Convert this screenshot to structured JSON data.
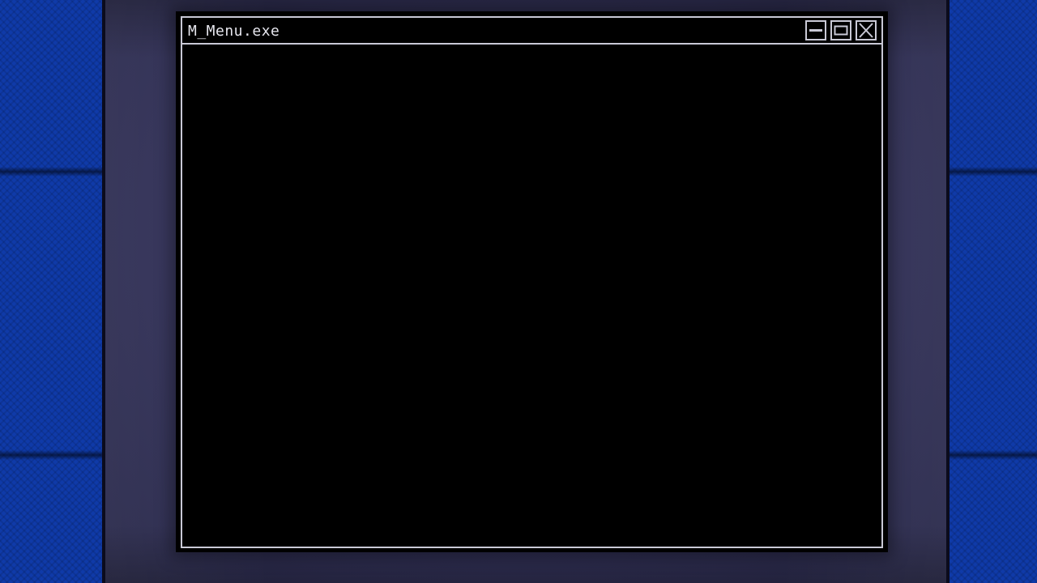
{
  "window": {
    "title": "M_Menu.exe",
    "controls": {
      "minimize_icon": "minimize-icon",
      "maximize_icon": "maximize-icon",
      "close_icon": "close-icon"
    }
  },
  "colors": {
    "wall": "#0f3aa8",
    "bezel": "#34335a",
    "window_border": "#c9c9d6",
    "window_background": "#000000",
    "title_text": "#e6e6ee"
  }
}
